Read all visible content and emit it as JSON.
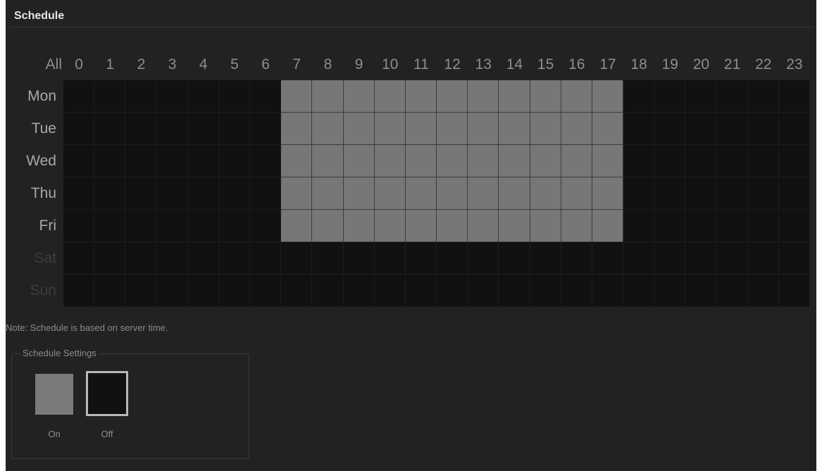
{
  "title": "Schedule",
  "all_label": "All",
  "hours": [
    "0",
    "1",
    "2",
    "3",
    "4",
    "5",
    "6",
    "7",
    "8",
    "9",
    "10",
    "11",
    "12",
    "13",
    "14",
    "15",
    "16",
    "17",
    "18",
    "19",
    "20",
    "21",
    "22",
    "23"
  ],
  "days": [
    "Mon",
    "Tue",
    "Wed",
    "Thu",
    "Fri",
    "Sat",
    "Sun"
  ],
  "schedule": {
    "Mon": {
      "on_from": 7,
      "on_to": 17
    },
    "Tue": {
      "on_from": 7,
      "on_to": 17
    },
    "Wed": {
      "on_from": 7,
      "on_to": 17
    },
    "Thu": {
      "on_from": 7,
      "on_to": 17
    },
    "Fri": {
      "on_from": 7,
      "on_to": 17
    },
    "Sat": null,
    "Sun": null
  },
  "note": "Note: Schedule is based on server time.",
  "settings": {
    "legend": "Schedule Settings",
    "on_label": "On",
    "off_label": "Off",
    "selected": "Off"
  },
  "colors": {
    "on": "#777777",
    "off": "#111111"
  }
}
